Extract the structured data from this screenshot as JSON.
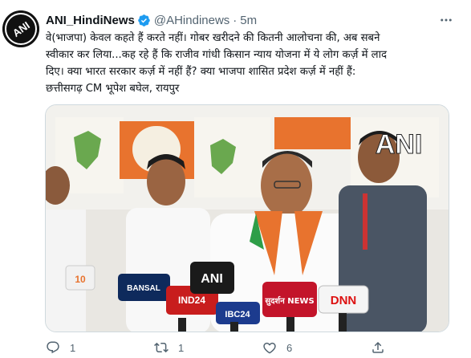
{
  "tweet": {
    "author_name": "ANI_HindiNews",
    "handle": "@AHindinews",
    "separator": "·",
    "time": "5m",
    "avatar_logo_text": "ANI",
    "text_lines": [
      "वे(भाजपा) केवल कहते हैं करते नहीं। गोबर खरीदने की कितनी आलोचना की, अब सबने",
      "स्वीकार कर लिया...कह रहे हैं कि राजीव गांधी किसान न्याय योजना में ये लोग कर्ज़ में लाद",
      "दिए। क्या भारत सरकार कर्ज़ में नहीं हैं? क्या भाजपा शासित प्रदेश कर्ज़ में नहीं हैं:",
      "छत्तीसगढ़ CM भूपेश बघेल, रायपुर"
    ],
    "media": {
      "watermark": "ANI",
      "mic_labels": [
        "10",
        "BANSAL",
        "IND24",
        "ANI",
        "IBC24",
        "सुदर्शन NEWS",
        "DNN"
      ]
    },
    "actions": {
      "reply_count": "1",
      "retweet_count": "1",
      "like_count": "6"
    }
  },
  "colors": {
    "verified": "#1d9bf0",
    "secondary_text": "#536471"
  }
}
